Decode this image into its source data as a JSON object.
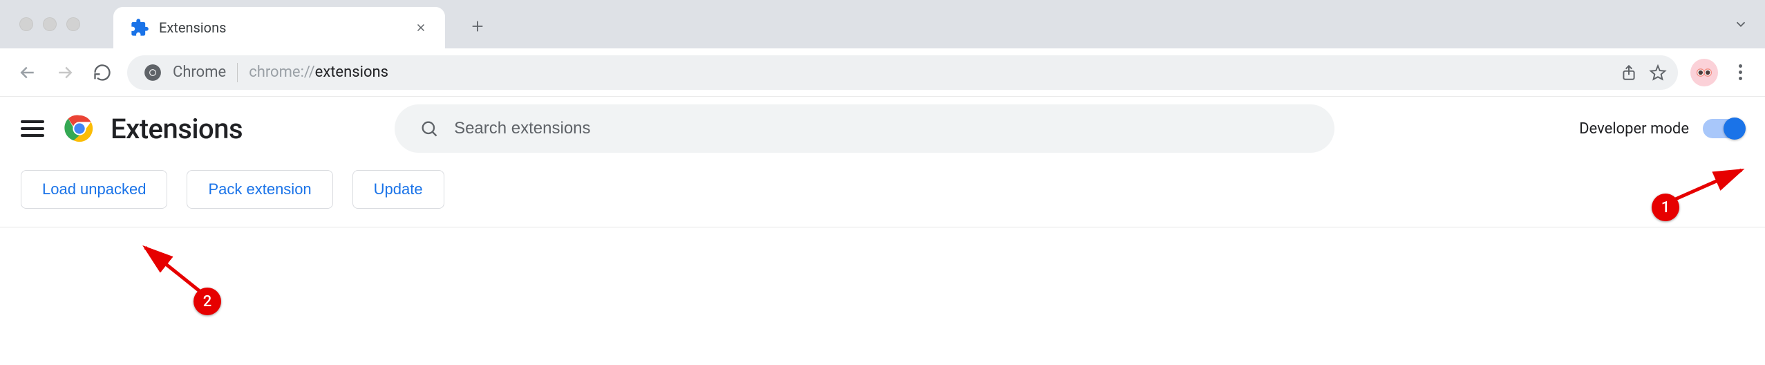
{
  "tab": {
    "title": "Extensions"
  },
  "address": {
    "vendor_label": "Chrome",
    "url_prefix": "chrome://",
    "url_bold": "extensions"
  },
  "page": {
    "title": "Extensions",
    "search_placeholder": "Search extensions",
    "developer_mode_label": "Developer mode",
    "developer_mode_on": true
  },
  "dev_buttons": {
    "load_unpacked": "Load unpacked",
    "pack_extension": "Pack extension",
    "update": "Update"
  },
  "annotations": {
    "badge1": "1",
    "badge2": "2"
  },
  "colors": {
    "accent": "#1a73e8",
    "annotation": "#e60000"
  }
}
